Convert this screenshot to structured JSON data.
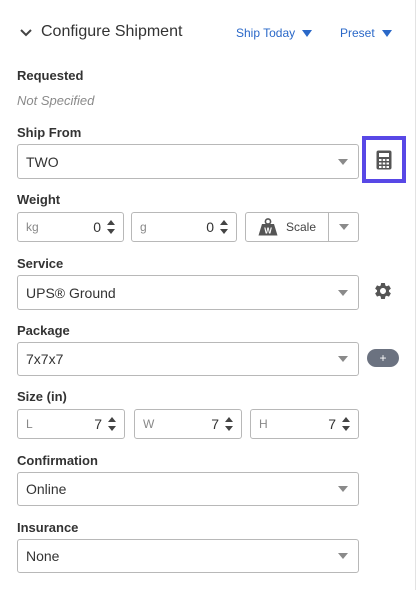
{
  "header": {
    "title": "Configure Shipment",
    "ship_today_label": "Ship Today",
    "preset_label": "Preset"
  },
  "requested": {
    "label": "Requested",
    "value": "Not Specified"
  },
  "ship_from": {
    "label": "Ship From",
    "value": "TWO"
  },
  "weight": {
    "label": "Weight",
    "kg_unit": "kg",
    "kg_value": "0",
    "g_unit": "g",
    "g_value": "0",
    "scale_label": "Scale",
    "scale_icon_letter": "W"
  },
  "service": {
    "label": "Service",
    "value": "UPS® Ground"
  },
  "package": {
    "label": "Package",
    "value": "7x7x7",
    "add_symbol": "+"
  },
  "size": {
    "label": "Size (in)",
    "l_unit": "L",
    "l_value": "7",
    "w_unit": "W",
    "w_value": "7",
    "h_unit": "H",
    "h_value": "7"
  },
  "confirmation": {
    "label": "Confirmation",
    "value": "Online"
  },
  "insurance": {
    "label": "Insurance",
    "value": "None"
  },
  "colors": {
    "accent": "#2a68c8",
    "highlight": "#5848e6",
    "pill": "#6b7280"
  },
  "icons": [
    "chevron-down-icon",
    "calculator-icon",
    "scale-weight-icon",
    "gear-icon",
    "plus-icon"
  ]
}
